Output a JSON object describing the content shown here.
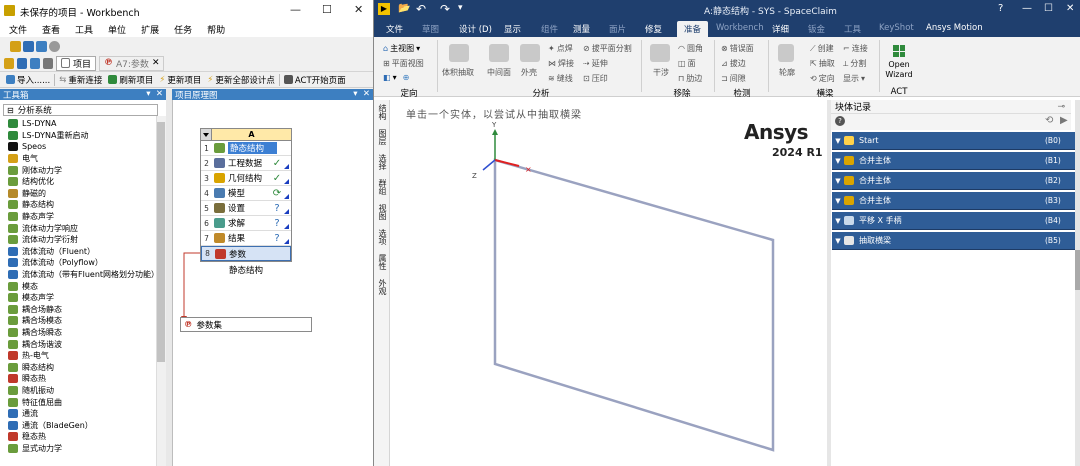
{
  "workbench": {
    "title": "未保存的项目 - Workbench",
    "window_controls": [
      "—",
      "☐",
      "✕"
    ],
    "menu": [
      "文件",
      "查看",
      "工具",
      "单位",
      "扩展",
      "任务",
      "帮助"
    ],
    "tabs": [
      {
        "label": "项目"
      },
      {
        "label": "A7:参数"
      }
    ],
    "toolbar": [
      "导入......",
      "重新连接",
      "刷新项目",
      "更新项目",
      "更新全部设计点",
      "ACT开始页面"
    ],
    "toolbox": {
      "header": "工具箱",
      "header_controls": "▾ ‌ ✕",
      "category": "分析系统",
      "items": [
        {
          "label": "LS-DYNA",
          "color": "#2f8a3c"
        },
        {
          "label": "LS-DYNA重新启动",
          "color": "#2f8a3c"
        },
        {
          "label": "Speos",
          "color": "#111111"
        },
        {
          "label": "电气",
          "color": "#d4a017"
        },
        {
          "label": "刚体动力学",
          "color": "#6a9c3c"
        },
        {
          "label": "结构优化",
          "color": "#6a9c3c"
        },
        {
          "label": "静磁的",
          "color": "#b58a2a"
        },
        {
          "label": "静态结构",
          "color": "#6a9c3c"
        },
        {
          "label": "静态声学",
          "color": "#6a9c3c"
        },
        {
          "label": "流体动力学响应",
          "color": "#6a9c3c"
        },
        {
          "label": "流体动力学衍射",
          "color": "#6a9c3c"
        },
        {
          "label": "流体流动（Fluent）",
          "color": "#2f6db5"
        },
        {
          "label": "流体流动（Polyflow）",
          "color": "#2f6db5"
        },
        {
          "label": "流体流动（带有Fluent网格划分功能）",
          "color": "#2f6db5"
        },
        {
          "label": "模态",
          "color": "#6a9c3c"
        },
        {
          "label": "模态声学",
          "color": "#6a9c3c"
        },
        {
          "label": "耦合场静态",
          "color": "#6a9c3c"
        },
        {
          "label": "耦合场模态",
          "color": "#6a9c3c"
        },
        {
          "label": "耦合场瞬态",
          "color": "#6a9c3c"
        },
        {
          "label": "耦合场谐波",
          "color": "#6a9c3c"
        },
        {
          "label": "热-电气",
          "color": "#c0392b"
        },
        {
          "label": "瞬态结构",
          "color": "#6a9c3c"
        },
        {
          "label": "瞬态热",
          "color": "#c0392b"
        },
        {
          "label": "随机振动",
          "color": "#6a9c3c"
        },
        {
          "label": "特征值屈曲",
          "color": "#6a9c3c"
        },
        {
          "label": "通流",
          "color": "#2f6db5"
        },
        {
          "label": "通流（BladeGen）",
          "color": "#2f6db5"
        },
        {
          "label": "稳态热",
          "color": "#c0392b"
        },
        {
          "label": "显式动力学",
          "color": "#6a9c3c"
        }
      ]
    },
    "schematic": {
      "header": "项目原理图",
      "header_controls": "▾ ‌ ✕",
      "system": {
        "column": "A",
        "rows": [
          {
            "num": "1",
            "label": "静态结构",
            "status": "",
            "color": "#6a9c3c"
          },
          {
            "num": "2",
            "label": "工程数据",
            "status": "✓",
            "color": "#5a6e9c"
          },
          {
            "num": "3",
            "label": "几何结构",
            "status": "✓",
            "color": "#d9a400"
          },
          {
            "num": "4",
            "label": "模型",
            "status": "⟳",
            "color": "#4a7bb0"
          },
          {
            "num": "5",
            "label": "设置",
            "status": "?",
            "color": "#7a6e3c"
          },
          {
            "num": "6",
            "label": "求解",
            "status": "?",
            "color": "#4a9c8c"
          },
          {
            "num": "7",
            "label": "结果",
            "status": "?",
            "color": "#c08a2a"
          },
          {
            "num": "8",
            "label": "参数",
            "status": "",
            "color": "#c0392b"
          }
        ],
        "caption": "静态结构"
      },
      "parameter_set": "参数集"
    }
  },
  "spaceclaim": {
    "title": "A:静态结构 - SYS - SpaceClaim",
    "qat": [
      "▶",
      "📂",
      "↶",
      "↷",
      "▾"
    ],
    "window_controls": [
      "?",
      "—",
      "☐",
      "✕"
    ],
    "menu": [
      {
        "label": "文件",
        "state": "normal"
      },
      {
        "label": "草图",
        "state": "dim"
      },
      {
        "label": "设计 (D)",
        "state": "normal"
      },
      {
        "label": "显示",
        "state": "normal"
      },
      {
        "label": "组件",
        "state": "dim"
      },
      {
        "label": "测量",
        "state": "normal"
      },
      {
        "label": "面片",
        "state": "dim"
      },
      {
        "label": "修复",
        "state": "normal"
      },
      {
        "label": "准备",
        "state": "active"
      },
      {
        "label": "Workbench",
        "state": "dim"
      },
      {
        "label": "详细",
        "state": "normal"
      },
      {
        "label": "钣金",
        "state": "dim"
      },
      {
        "label": "工具",
        "state": "dim"
      },
      {
        "label": "KeyShot",
        "state": "dim"
      },
      {
        "label": "Ansys Motion",
        "state": "normal"
      }
    ],
    "ribbon": {
      "orient": {
        "label": "定向",
        "main_view": "主视图",
        "plane_view": "平面视图",
        "view_btn": "▾"
      },
      "analysis": {
        "label": "分析",
        "buttons": [
          "体积抽取",
          "中间面",
          "外壳"
        ],
        "small": [
          "点焊",
          "焊接",
          "缝线",
          "拔平面分割",
          "延伸",
          "压印"
        ]
      },
      "remove": {
        "label": "移除",
        "big": "干涉",
        "small": [
          "圆角",
          "面",
          "肋边"
        ]
      },
      "detect": {
        "label": "检测",
        "small": [
          "错误面",
          "拔边",
          "间隙"
        ]
      },
      "beam": {
        "label": "横梁",
        "big": "轮廓",
        "small": [
          "创建",
          "抽取",
          "定向",
          "连接",
          "分割",
          "显示"
        ]
      },
      "act": {
        "label": "ACT",
        "big": "Open Wizard"
      }
    },
    "side_tabs": [
      "结构",
      "图层",
      "选择",
      "群组",
      "视图",
      "选项",
      "属性",
      "外观"
    ],
    "hint": "单击一个实体，以尝试从中抽取横梁",
    "brand": "Ansys",
    "brand_sub": "2024 R1",
    "triad": {
      "y": "Y",
      "z": "Z"
    },
    "history": {
      "header": "块体记录",
      "header_pin": "⊸",
      "tools": [
        "?",
        "⟲",
        "▶"
      ],
      "rows": [
        {
          "label": "Start",
          "id": "(B0)",
          "icon": "#ffd24a"
        },
        {
          "label": "合并主体",
          "id": "(B1)",
          "icon": "#d9a400"
        },
        {
          "label": "合并主体",
          "id": "(B2)",
          "icon": "#d9a400"
        },
        {
          "label": "合并主体",
          "id": "(B3)",
          "icon": "#d9a400"
        },
        {
          "label": "平移 X 手柄",
          "id": "(B4)",
          "icon": "#c9d9ea"
        },
        {
          "label": "抽取横梁",
          "id": "(B5)",
          "icon": "#e6e6e6"
        }
      ]
    }
  }
}
